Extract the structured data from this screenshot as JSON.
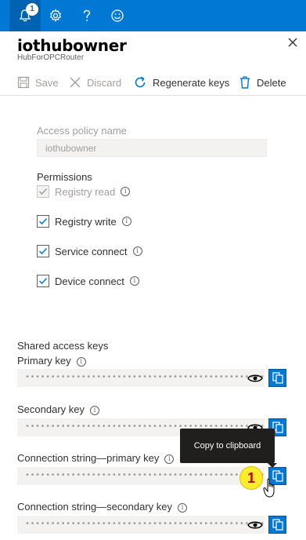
{
  "topbar": {
    "notification_count": "1",
    "icons": [
      "bell-icon",
      "gear-icon",
      "help-icon",
      "smiley-icon"
    ]
  },
  "blade": {
    "title": "iothubowner",
    "subtitle": "HubForOPCRouter"
  },
  "commands": {
    "save": "Save",
    "discard": "Discard",
    "regenerate": "Regenerate keys",
    "delete": "Delete"
  },
  "policy": {
    "name_label": "Access policy name",
    "name_value": "iothubowner",
    "permissions_label": "Permissions",
    "permissions": [
      {
        "label": "Registry read",
        "checked": true,
        "disabled": true
      },
      {
        "label": "Registry write",
        "checked": true,
        "disabled": false
      },
      {
        "label": "Service connect",
        "checked": true,
        "disabled": false
      },
      {
        "label": "Device connect",
        "checked": true,
        "disabled": false
      }
    ]
  },
  "keys": {
    "section_label": "Shared access keys",
    "fields": [
      {
        "label": "Primary key",
        "value": "••••••••••••••••••••••••••••••••••••••••••••••••••••"
      },
      {
        "label": "Secondary key",
        "value": "••••••••••••••••••••••••••••••••••••••••••••••••••••"
      },
      {
        "label": "Connection string—primary key",
        "value": "••••••••••••••••••••••••••••••••••••••••••••••••••••••••••"
      },
      {
        "label": "Connection string—secondary key",
        "value": "••••••••••••••••••••••••••••••••••••••••••••••••••••••••••"
      }
    ]
  },
  "tooltip": {
    "text": "Copy to clipboard"
  },
  "annotation": {
    "step": "1"
  },
  "colors": {
    "accent": "#0078d4",
    "badge": "#ffed2b",
    "badge_text": "#c00000"
  }
}
